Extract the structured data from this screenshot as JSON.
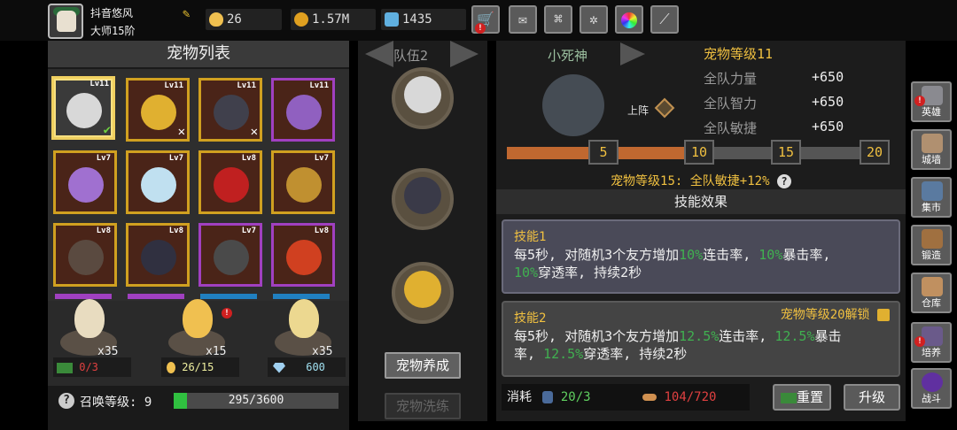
{
  "player": {
    "name": "抖音悠风",
    "title": "大师15阶"
  },
  "resources": {
    "eggs": "26",
    "coins": "1.57M",
    "gems": "1435"
  },
  "pet_list": {
    "title": "宠物列表",
    "pets": [
      {
        "level": "Lv11",
        "mark": "✔"
      },
      {
        "level": "Lv11",
        "mark": "✕"
      },
      {
        "level": "Lv11",
        "mark": "✕"
      },
      {
        "level": "Lv11",
        "mark": ""
      },
      {
        "level": "Lv7",
        "mark": ""
      },
      {
        "level": "Lv7",
        "mark": ""
      },
      {
        "level": "Lv8",
        "mark": ""
      },
      {
        "level": "Lv7",
        "mark": ""
      },
      {
        "level": "Lv8",
        "mark": ""
      },
      {
        "level": "Lv8",
        "mark": ""
      },
      {
        "level": "Lv7",
        "mark": ""
      },
      {
        "level": "Lv8",
        "mark": ""
      }
    ]
  },
  "eggs": [
    {
      "count": "x35",
      "stat": "0/3"
    },
    {
      "count": "x15",
      "stat": "26/15"
    },
    {
      "count": "x35",
      "stat": "600"
    }
  ],
  "summon": {
    "label": "召唤等级: 9",
    "progress_text": "295/3600",
    "progress": 0.082
  },
  "team": {
    "label": "队伍2",
    "train_button": "宠物养成",
    "wash_button": "宠物洗练"
  },
  "detail": {
    "pet_name": "小死神",
    "deploy_label": "上阵",
    "level_title": "宠物等级11",
    "stats": [
      {
        "name": "全队力量",
        "value": "+650"
      },
      {
        "name": "全队智力",
        "value": "+650"
      },
      {
        "name": "全队敏捷",
        "value": "+650"
      }
    ],
    "milestones": [
      "5",
      "10",
      "15",
      "20"
    ],
    "bonus_text": "宠物等级15: 全队敏捷+12%",
    "skill_header": "技能效果",
    "skill1": {
      "title": "技能1",
      "t1": "每5秒, 对随机3个友方增加",
      "h1": "10%",
      "t2": "连击率,",
      "h2": "10%",
      "t3": "暴击率,",
      "h3": "10%",
      "t4": "穿透率, 持续2秒"
    },
    "skill2": {
      "title": "技能2",
      "unlock": "宠物等级20解锁",
      "t1": "每5秒, 对随机3个友方增加",
      "h1": "12.5%",
      "t2": "连击率,",
      "h2": "12.5%",
      "t3": "暴击率,",
      "t3b": "率,",
      "h3": "12.5%",
      "t4": "穿透率, 持续2秒"
    },
    "cost_label": "消耗",
    "cost1": "20/3",
    "cost2": "104/720",
    "reset_button": "重置",
    "upgrade_button": "升级"
  },
  "sidebar": [
    "英雄",
    "城墙",
    "集市",
    "锻造",
    "仓库",
    "培养",
    "战斗"
  ]
}
